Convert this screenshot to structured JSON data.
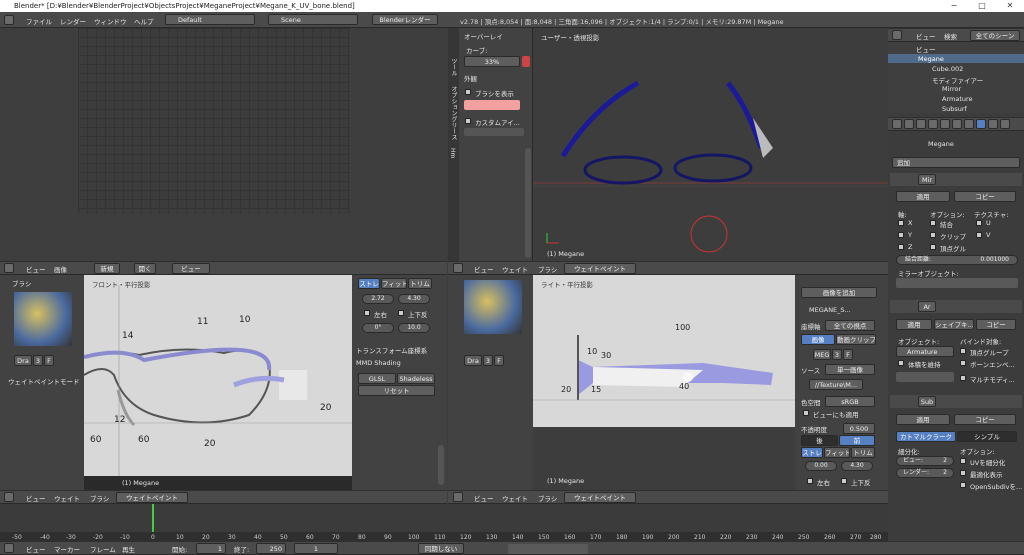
{
  "window": {
    "title": "Blender* [D:¥Blender¥BlenderProject¥ObjectsProject¥MeganeProject¥Megane_K_UV_bone.blend]",
    "min": "−",
    "max": "□",
    "close": "✕"
  },
  "menu": {
    "items": [
      "ファイル",
      "レンダー",
      "ウィンドウ",
      "ヘルプ"
    ],
    "layout": "Default",
    "scene": "Scene",
    "engine": "Blenderレンダー",
    "stats": "v2.78 | 頂点:8,054 | 面:8,048 | 三角面:16,096 | オブジェクト:1/4 | ランプ:0/1 | メモリ:29.87M | Megane"
  },
  "top_left": {},
  "tool_panel": {
    "tabs": [
      "ツール",
      "オプション",
      "グリース",
      "Hm"
    ],
    "overlay": "オーバーレイ",
    "curve": "カーブ:",
    "percent": "33%",
    "outline": "外観",
    "show_brush": "ブラシを表示",
    "custom": "カスタムアイ..."
  },
  "viewport3d": {
    "title": "ユーザー・透視投影",
    "object": "(1) Megane"
  },
  "header_mid_left": {
    "view": "ビュー",
    "image": "画像",
    "new": "新規",
    "open": "開く",
    "view2": "ビュー"
  },
  "uv_tools": {
    "brush": "ブラシ",
    "tabs": [
      "ツ",
      "オプ",
      "スロ",
      "グリース",
      "Hm"
    ],
    "dra": "Dra",
    "three": "3",
    "f": "F",
    "weight_mode": "ウェイトペイントモード"
  },
  "front_view": {
    "title": "フロント・平行投影",
    "object": "(1) Megane",
    "numbers": [
      "14",
      "11",
      "10",
      "12",
      "60",
      "60",
      "20",
      "20"
    ]
  },
  "front_props": {
    "stretch": "ストレ",
    "fit": "フィット",
    "trim": "トリム",
    "val1": "2.72",
    "val2": "4.30",
    "lr": "左右",
    "tb": "上下反",
    "rot": "0°",
    "ten": "10.0",
    "transform": "トランスフォーム座標系",
    "mmd": "MMD Shading",
    "glsl": "GLSL",
    "shadeless": "Shadeless",
    "reset": "リセット"
  },
  "side_view": {
    "title": "ライト・平行投影",
    "object": "(1) Megane",
    "numbers": [
      "100",
      "10",
      "30",
      "20",
      "15",
      "40"
    ]
  },
  "side_props": {
    "add_image": "画像を追加",
    "name": "MEGANE_S...",
    "coord": "座標軸",
    "all_views": "全ての視点",
    "image_btn": "画像",
    "movie_clip": "動画クリップ",
    "meg": "MEG",
    "three": "3",
    "f": "F",
    "source": "ソース",
    "single_image": "単一画像",
    "path": "//Texture\\M...",
    "colorspace": "色空間",
    "srgb": "sRGB",
    "also_view": "ビューにも適用",
    "opacity": "不透明度",
    "opacity_val": "0.500",
    "back": "後",
    "front": "前",
    "stretch": "ストレ",
    "fit": "フィット",
    "trim": "トリム",
    "v1": "0.00",
    "v2": "4.30",
    "lr": "左右",
    "tb": "上下反"
  },
  "bottom_headers": {
    "view": "ビュー",
    "weight": "ウェイト",
    "brush": "ブラシ",
    "mode": "ウェイトペイント"
  },
  "timeline": {
    "ticks": [
      "-50",
      "-40",
      "-30",
      "-20",
      "-10",
      "0",
      "10",
      "20",
      "30",
      "40",
      "50",
      "60",
      "70",
      "80",
      "90",
      "100",
      "110",
      "120",
      "130",
      "140",
      "150",
      "160",
      "170",
      "180",
      "190",
      "200",
      "210",
      "220",
      "230",
      "240",
      "250",
      "260",
      "270",
      "280"
    ],
    "view": "ビュー",
    "marker": "マーカー",
    "frame": "フレーム",
    "play": "再生",
    "start_label": "開始:",
    "start": "1",
    "end_label": "終了:",
    "end": "250",
    "current": "1",
    "sync": "同期しない"
  },
  "outliner": {
    "view": "ビュー",
    "search": "検索",
    "all_scenes": "全てのシーン",
    "items": [
      "ビュー",
      "Megane",
      "Cube.002",
      "モディファイアー",
      "Mirror",
      "Armature",
      "Subsurf"
    ]
  },
  "properties": {
    "object": "Megane",
    "add": "追加",
    "mirror": {
      "name": "Mir",
      "apply": "適用",
      "copy": "コピー",
      "axis": "軸:",
      "options": "オプション:",
      "texture": "テクスチャ:",
      "x": "X",
      "y": "Y",
      "z": "Z",
      "merge": "結合",
      "clip": "クリップ",
      "vgroup": "頂点グル",
      "u": "U",
      "v": "V",
      "merge_dist": "結合距離:",
      "merge_val": "0.001000",
      "mirror_obj": "ミラーオブジェクト:"
    },
    "armature": {
      "name": "Ar",
      "apply": "適用",
      "shape": "シェイプキ...",
      "copy": "コピー",
      "object": "オブジェクト:",
      "bind": "バインド対象:",
      "arm_obj": "Armature",
      "vgroup": "頂点グループ",
      "keep_vol": "体積を維持",
      "bone_env": "ボーンエンベ...",
      "multi": "マルチモディ..."
    },
    "subsurf": {
      "name": "Sub",
      "apply": "適用",
      "copy": "コピー",
      "catmull": "カトマルクラーク",
      "simple": "シンプル",
      "subdiv": "細分化:",
      "options": "オプション:",
      "view": "ビュー:",
      "view_val": "2",
      "render": "レンダー:",
      "render_val": "2",
      "smooth_uv": "UVを細分化",
      "optimal": "最適化表示",
      "opensubdiv": "OpenSubdivを..."
    }
  }
}
